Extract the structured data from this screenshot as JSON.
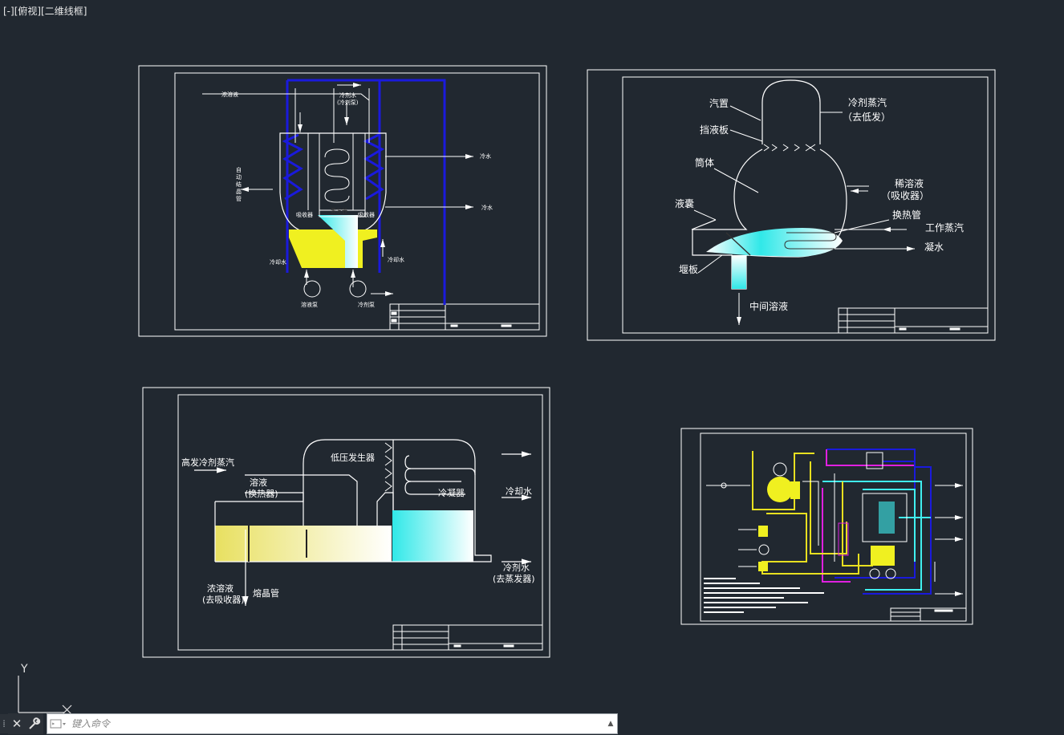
{
  "viewport": {
    "label": "[-][俯视][二维线框]"
  },
  "ucs": {
    "y_label": "Y",
    "x_label": "X"
  },
  "command_line": {
    "placeholder": "键入命令"
  },
  "colors": {
    "background": "#212830",
    "frame": "#ffffff",
    "blue_pipe": "#1a1adc",
    "yellow_fill": "#f0f020",
    "cyan_fill": "#40f0f0",
    "magenta": "#e020e0",
    "yellow_line": "#e8e020"
  },
  "drawing1": {
    "labels": {
      "concentrated": "浓溶液",
      "refrigerant_water": "冷剂水",
      "refrigerant_pump_note": "(冷剂泵)",
      "auto_crystal_1": "自",
      "auto_crystal_2": "动",
      "auto_crystal_3": "结",
      "auto_crystal_4": "晶",
      "auto_crystal_5": "管",
      "absorber_left": "吸收器",
      "evaporator": "蒸发器",
      "absorber_right": "吸收器",
      "cold_water_1": "冷水",
      "cold_water_2": "冷水",
      "cooling_water_left": "冷却水",
      "cooling_water_right": "冷却水",
      "solution_pump": "溶液泵",
      "refrigerant_pump": "冷剂泵"
    }
  },
  "drawing2": {
    "labels": {
      "steam_drum": "汽置",
      "baffle": "挡液板",
      "shell": "筒体",
      "sump": "液囊",
      "weir": "堰板",
      "refrigerant_vapor": "冷剂蒸汽",
      "to_low_gen": "（去低发）",
      "dilute_solution": "稀溶液",
      "from_absorber": "（吸收器）",
      "heat_tube": "换热管",
      "working_steam": "工作蒸汽",
      "condensate": "凝水",
      "intermediate_solution": "中间溶液"
    }
  },
  "drawing3": {
    "labels": {
      "high_gen_vapor": "高发冷剂蒸汽",
      "solution": "溶液",
      "heat_exchanger": "(换热器)",
      "low_pressure_gen": "低压发生器",
      "condenser": "冷凝器",
      "cooling_water": "冷却水",
      "refrigerant_water": "冷剂水",
      "to_evaporator": "(去蒸发器)",
      "concentrated_solution": "浓溶液",
      "to_absorber": "(去吸收器)",
      "crystal_tube": "熔晶管"
    }
  }
}
